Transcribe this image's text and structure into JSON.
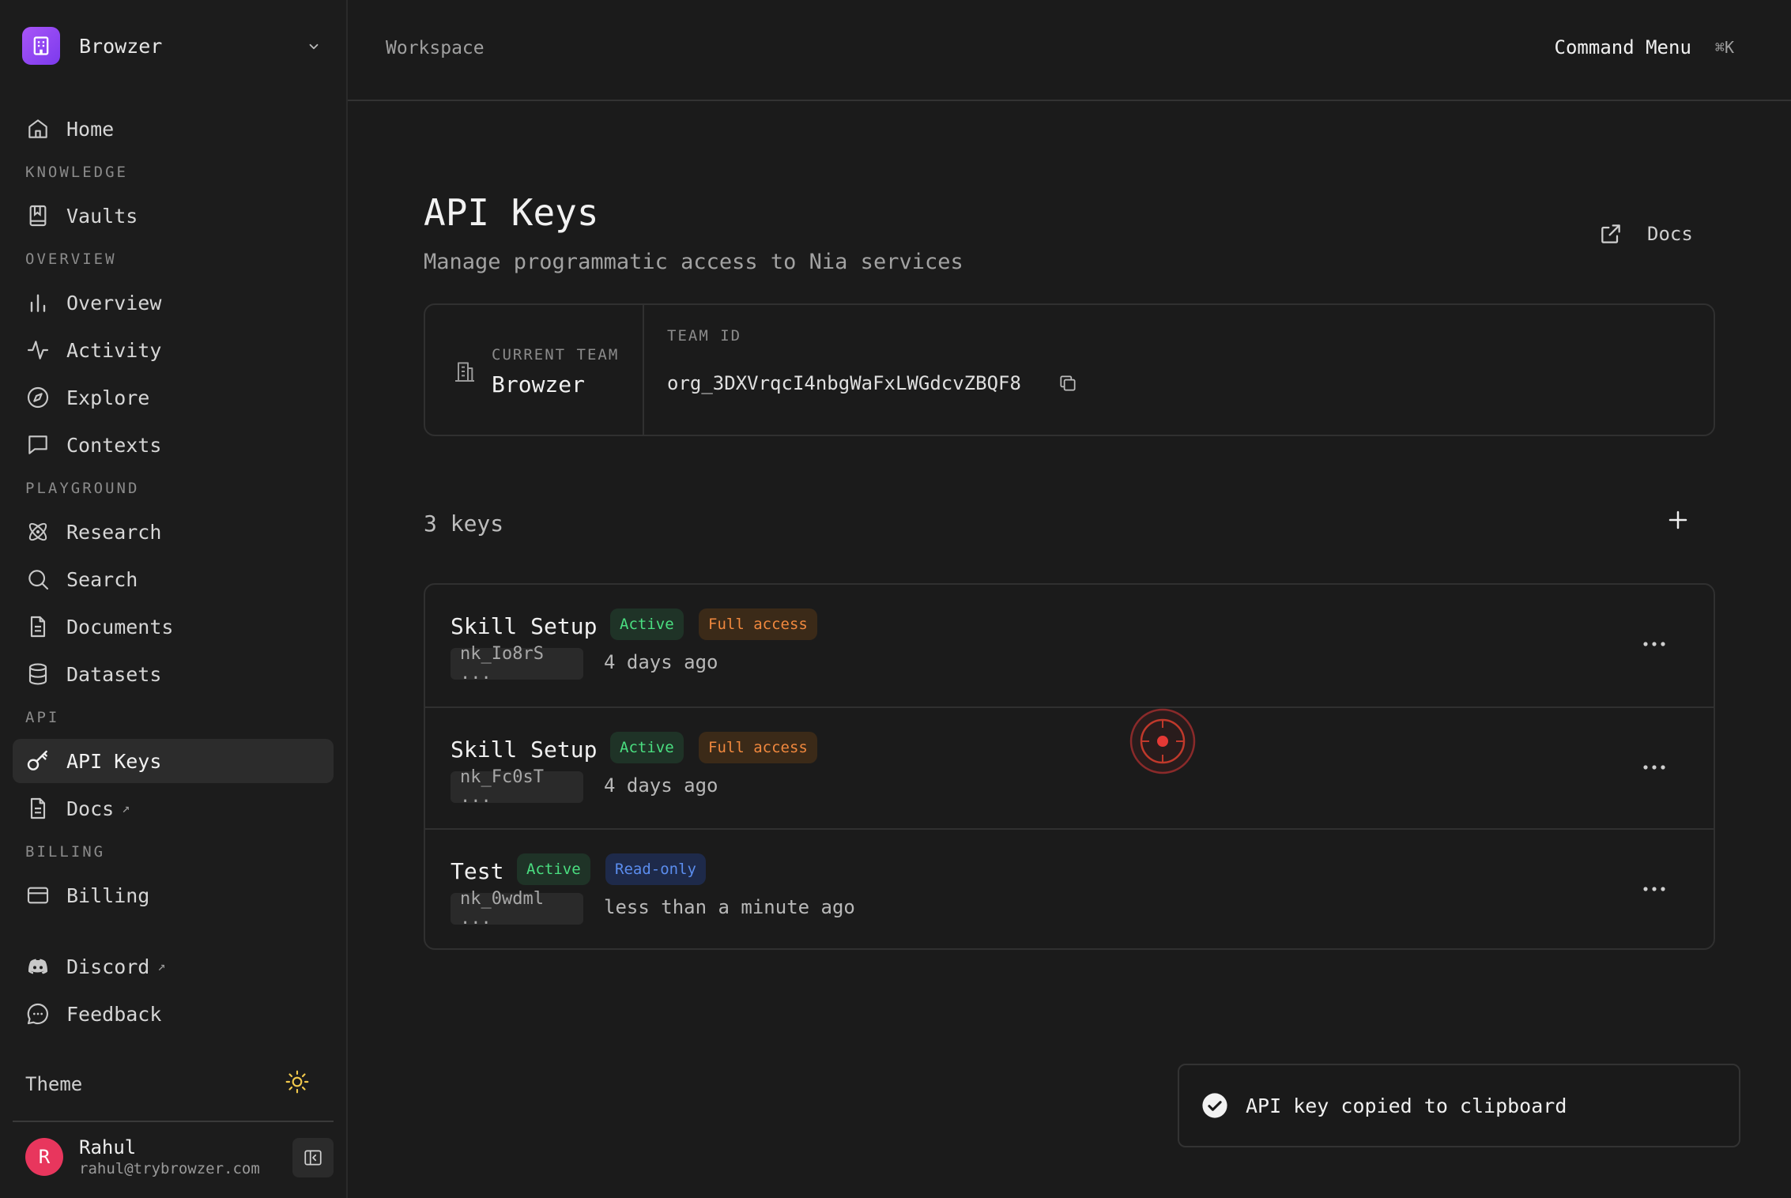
{
  "sidebar": {
    "brand": "Browzer",
    "home": "Home",
    "sections": {
      "knowledge": "KNOWLEDGE",
      "overview": "OVERVIEW",
      "playground": "PLAYGROUND",
      "api": "API",
      "billing": "BILLING"
    },
    "items": {
      "vaults": "Vaults",
      "overview": "Overview",
      "activity": "Activity",
      "explore": "Explore",
      "contexts": "Contexts",
      "research": "Research",
      "search": "Search",
      "documents": "Documents",
      "datasets": "Datasets",
      "api_keys": "API Keys",
      "docs": "Docs",
      "billing": "Billing",
      "discord": "Discord",
      "feedback": "Feedback"
    },
    "external_arrow": "↗",
    "theme_label": "Theme",
    "user": {
      "initial": "R",
      "name": "Rahul",
      "email": "rahul@trybrowzer.com"
    }
  },
  "topbar": {
    "breadcrumb": "Workspace",
    "command_menu": "Command Menu",
    "shortcut": "⌘K"
  },
  "page": {
    "title": "API Keys",
    "subtitle": "Manage programmatic access to Nia services",
    "docs_link": "Docs"
  },
  "team": {
    "label": "CURRENT TEAM",
    "name": "Browzer",
    "id_label": "TEAM ID",
    "id_value": "org_3DXVrqcI4nbgWaFxLWGdcvZBQF8"
  },
  "keys": {
    "count_label": "3 keys",
    "items": [
      {
        "name": "Skill Setup",
        "status": "Active",
        "access": "Full access",
        "masked": "nk_Io8rS ...",
        "time": "4 days ago"
      },
      {
        "name": "Skill Setup",
        "status": "Active",
        "access": "Full access",
        "masked": "nk_Fc0sT ...",
        "time": "4 days ago"
      },
      {
        "name": "Test",
        "status": "Active",
        "access": "Read-only",
        "masked": "nk_0wdml ...",
        "time": "less than a minute ago"
      }
    ]
  },
  "toast": {
    "message": "API key copied to clipboard"
  },
  "colors": {
    "background": "#1b1b1b",
    "active_badge": "#4ade80",
    "full_access_badge": "#f0883e",
    "read_only_badge": "#5b8dee",
    "brand": "#8b5cf6",
    "avatar": "#e8365d"
  }
}
